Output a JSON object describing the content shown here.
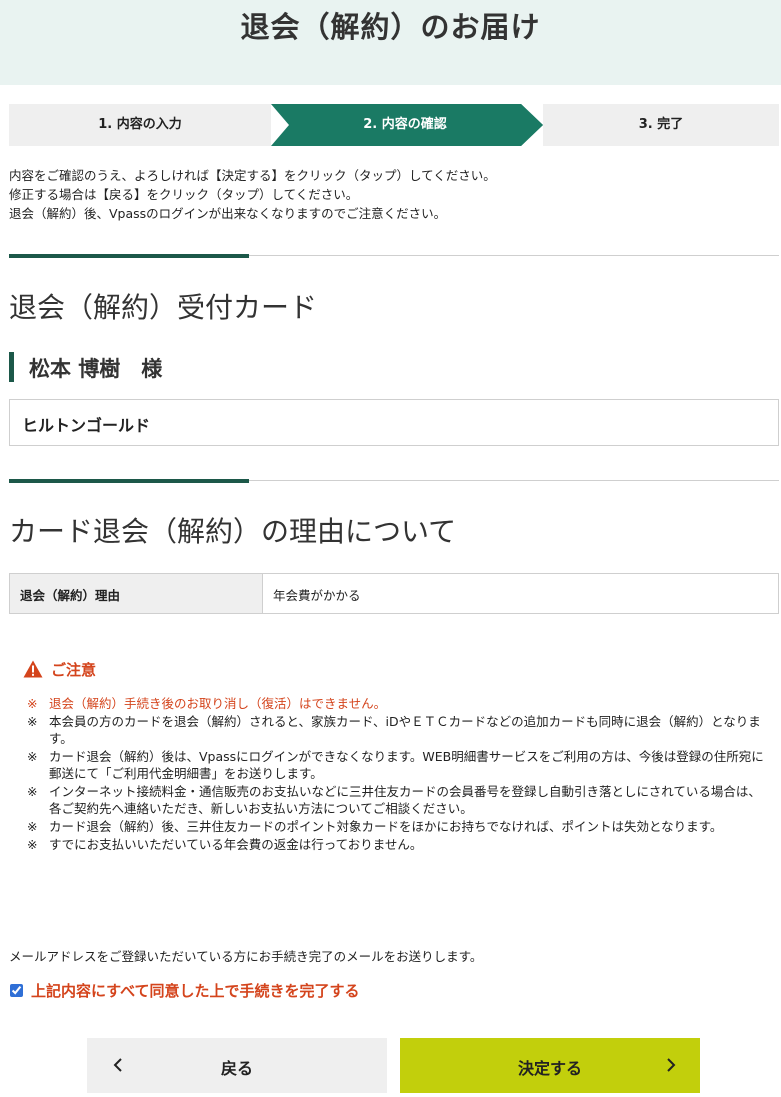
{
  "header": {
    "title": "退会（解約）のお届け"
  },
  "steps": [
    {
      "label": "1. 内容の入力"
    },
    {
      "label": "2. 内容の確認"
    },
    {
      "label": "3. 完了"
    }
  ],
  "intro": {
    "line1": "内容をご確認のうえ、よろしければ【決定する】をクリック（タップ）してください。",
    "line2": "修正する場合は【戻る】をクリック（タップ）してください。",
    "line3": "退会（解約）後、Vpassのログインが出来なくなりますのでご注意ください。"
  },
  "card_section": {
    "title": "退会（解約）受付カード",
    "holder_name": "松本 博樹　様",
    "card_name": "ヒルトンゴールド"
  },
  "reason_section": {
    "title": "カード退会（解約）の理由について",
    "label": "退会（解約）理由",
    "value": "年会費がかかる"
  },
  "notice": {
    "title": "ご注意",
    "mark": "※",
    "items": [
      "退会（解約）手続き後のお取り消し（復活）はできません。",
      "本会員の方のカードを退会（解約）されると、家族カード、iDやＥＴＣカードなどの追加カードも同時に退会（解約）となります。",
      "カード退会（解約）後は、Vpassにログインができなくなります。WEB明細書サービスをご利用の方は、今後は登録の住所宛に郵送にて「ご利用代金明細書」をお送りします。",
      "インターネット接続料金・通信販売のお支払いなどに三井住友カードの会員番号を登録し自動引き落としにされている場合は、各ご契約先へ連絡いただき、新しいお支払い方法についてご相談ください。",
      "カード退会（解約）後、三井住友カードのポイント対象カードをほかにお持ちでなければ、ポイントは失効となります。",
      "すでにお支払いいただいている年会費の返金は行っておりません。"
    ]
  },
  "mail_notice": "メールアドレスをご登録いただいている方にお手続き完了のメールをお送りします。",
  "agree_label": "上記内容にすべて同意した上で手続きを完了する",
  "buttons": {
    "back": "戻る",
    "submit": "決定する"
  },
  "colors": {
    "accent": "#1c5849",
    "step_active": "#1a7a64",
    "warning": "#d4441c",
    "submit": "#c2cf0c"
  }
}
